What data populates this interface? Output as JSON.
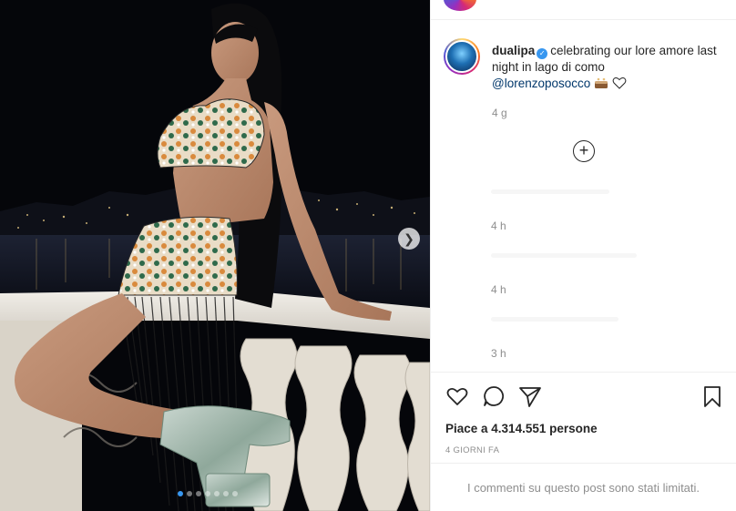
{
  "post": {
    "username": "dualipa",
    "caption_text": "celebrating our lore amore last night in lago di como",
    "mention": "@lorenzoposocco",
    "caption_time": "4 g",
    "carousel_dots": 7,
    "carousel_active_index": 0
  },
  "comments": [
    {
      "time": "4 h"
    },
    {
      "time": "4 h"
    },
    {
      "time": "3 h"
    }
  ],
  "actions": {
    "like_icon": "heart-icon",
    "comment_icon": "comment-icon",
    "share_icon": "send-icon",
    "save_icon": "bookmark-icon",
    "load_more_icon": "plus-circle-icon"
  },
  "likes_text": "Piace a 4.314.551 persone",
  "date_text": "4 GIORNI FA",
  "comments_limited_text": "I commenti su questo post sono stati limitati.",
  "colors": {
    "verified": "#3897f0",
    "mention": "#00376b",
    "muted": "#8e8e8e",
    "active_dot": "#3897f0"
  }
}
